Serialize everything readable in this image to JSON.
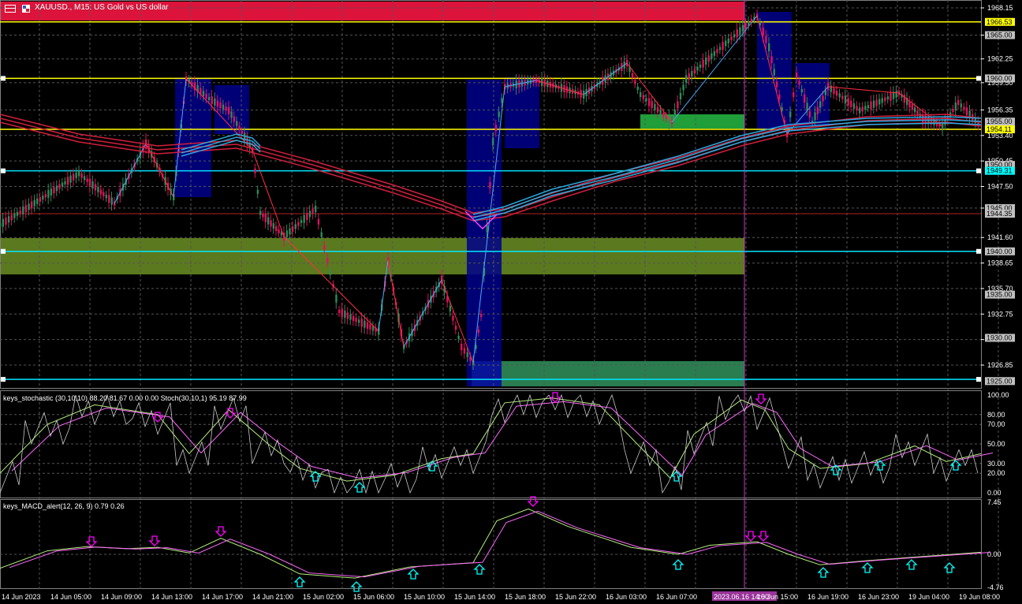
{
  "header": {
    "title": "XAUUSD., M15:  US Gold vs US dollar"
  },
  "indicators": {
    "stoch_label": "keys_stochastic (30,10,10) 88.20 81.67 0.00 0.00 Stoch(30,10,1) 95.19 87.99",
    "macd_label": "keys_MACD_alert(12, 26, 9) 0.79 0.26"
  },
  "price_axis": {
    "ticks": [
      "1968.15",
      "1965.00",
      "1962.25",
      "1959.50",
      "1956.35",
      "1953.40",
      "1950.45",
      "1947.50",
      "1945.00",
      "1941.60",
      "1938.65",
      "1935.70",
      "1932.75",
      "1929.80",
      "1926.85"
    ],
    "tick_values": [
      1968.15,
      1965.0,
      1962.25,
      1959.5,
      1956.35,
      1953.4,
      1950.45,
      1947.5,
      1945.0,
      1941.6,
      1938.65,
      1935.7,
      1932.75,
      1929.8,
      1926.85
    ],
    "labels": [
      {
        "text": "1966.53",
        "value": 1966.53,
        "bg": "#ffff00",
        "fg": "#000000"
      },
      {
        "text": "1965.00",
        "value": 1965.0,
        "bg": "#c0c0c0",
        "fg": "#000000"
      },
      {
        "text": "1960.00",
        "value": 1960.0,
        "bg": "#c0c0c0",
        "fg": "#000000"
      },
      {
        "text": "1955.00",
        "value": 1955.0,
        "bg": "#c0c0c0",
        "fg": "#000000"
      },
      {
        "text": "1954.11",
        "value": 1954.11,
        "bg": "#ffff00",
        "fg": "#000000"
      },
      {
        "text": "1950.00",
        "value": 1950.0,
        "bg": "#c0c0c0",
        "fg": "#000000"
      },
      {
        "text": "1949.31",
        "value": 1949.31,
        "bg": "#00ffff",
        "fg": "#000000"
      },
      {
        "text": "1945.00",
        "value": 1945.0,
        "bg": "#c0c0c0",
        "fg": "#000000"
      },
      {
        "text": "1944.35",
        "value": 1944.35,
        "bg": "#c0c0c0",
        "fg": "#000000"
      },
      {
        "text": "1940.00",
        "value": 1940.0,
        "bg": "#c0c0c0",
        "fg": "#000000"
      },
      {
        "text": "1935.00",
        "value": 1935.0,
        "bg": "#c0c0c0",
        "fg": "#000000"
      },
      {
        "text": "1930.00",
        "value": 1930.0,
        "bg": "#c0c0c0",
        "fg": "#000000"
      },
      {
        "text": "1925.00",
        "value": 1925.0,
        "bg": "#c0c0c0",
        "fg": "#000000"
      }
    ]
  },
  "stoch_axis": {
    "ticks": [
      "100.00",
      "80.00",
      "70.00",
      "50.00",
      "30.00",
      "20.00",
      "0.00"
    ],
    "tick_values": [
      100,
      80,
      70,
      50,
      30,
      20,
      0
    ]
  },
  "macd_axis": {
    "ticks": [
      "7.45",
      "0.00",
      "-4.76"
    ],
    "tick_values": [
      7.45,
      0,
      -4.76
    ]
  },
  "time_axis": {
    "labels": [
      "14 Jun 2023",
      "14 Jun 05:00",
      "14 Jun 09:00",
      "14 Jun 13:00",
      "14 Jun 17:00",
      "14 Jun 21:00",
      "15 Jun 02:00",
      "15 Jun 06:00",
      "15 Jun 10:00",
      "15 Jun 14:00",
      "15 Jun 18:00",
      "15 Jun 22:00",
      "16 Jun 03:00",
      "16 Jun 07:00",
      "2023.06.16 14:00",
      "16 Jun 15:00",
      "16 Jun 19:00",
      "16 Jun 23:00",
      "19 Jun 04:00",
      "19 Jun 08:00"
    ],
    "crosshair_label": "2023.06.16 14:00"
  },
  "colors": {
    "background": "#000000",
    "bull": "#2e8b57",
    "bear": "#e0115f",
    "ma_red": "#d21f3c",
    "ma_blue": "#29a8e0",
    "yellow_line": "#ffff00",
    "cyan_line": "#00e5ff",
    "resistance_zone": "#dc143c",
    "olive_zone": "#6b8e23",
    "green_zone": "#2e8b57",
    "navy_box": "#00008b",
    "crosshair": "#cc33cc",
    "arrow_up": "#00ffff",
    "arrow_down": "#ff00ff"
  },
  "icons": [
    "chart-menu-icon",
    "symbol-flag-icon"
  ]
}
